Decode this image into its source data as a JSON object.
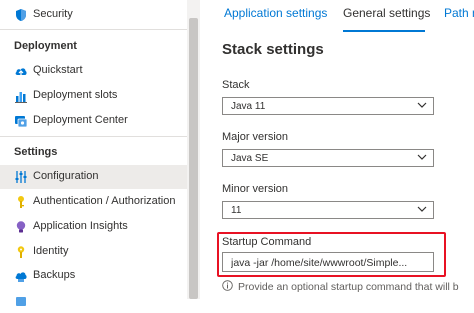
{
  "sidebar": {
    "items_top": [
      {
        "label": "Security",
        "icon": "shield-icon"
      }
    ],
    "sections": {
      "deployment": "Deployment",
      "settings": "Settings"
    },
    "deployment_items": [
      {
        "label": "Quickstart",
        "icon": "cloud-upload-icon"
      },
      {
        "label": "Deployment slots",
        "icon": "chart-bars-icon"
      },
      {
        "label": "Deployment Center",
        "icon": "deployment-center-icon"
      }
    ],
    "settings_items": [
      {
        "label": "Configuration",
        "icon": "sliders-icon",
        "selected": true
      },
      {
        "label": "Authentication / Authorization",
        "icon": "key-icon"
      },
      {
        "label": "Application Insights",
        "icon": "lightbulb-icon"
      },
      {
        "label": "Identity",
        "icon": "identity-key-icon"
      },
      {
        "label": "Backups",
        "icon": "backup-icon"
      }
    ]
  },
  "tabs": [
    {
      "label": "Application settings",
      "active": false
    },
    {
      "label": "General settings",
      "active": true
    },
    {
      "label": "Path m",
      "active": false
    }
  ],
  "stack_settings": {
    "heading": "Stack settings",
    "stack": {
      "label": "Stack",
      "value": "Java 11"
    },
    "major_version": {
      "label": "Major version",
      "value": "Java SE"
    },
    "minor_version": {
      "label": "Minor version",
      "value": "11"
    },
    "startup_command": {
      "label": "Startup Command",
      "value": "java -jar /home/site/wwwroot/Simple..."
    },
    "info_text": "Provide an optional startup command that will b"
  },
  "colors": {
    "accent": "#0078d4",
    "highlight": "#e81123",
    "selected_bg": "#edebe9"
  }
}
